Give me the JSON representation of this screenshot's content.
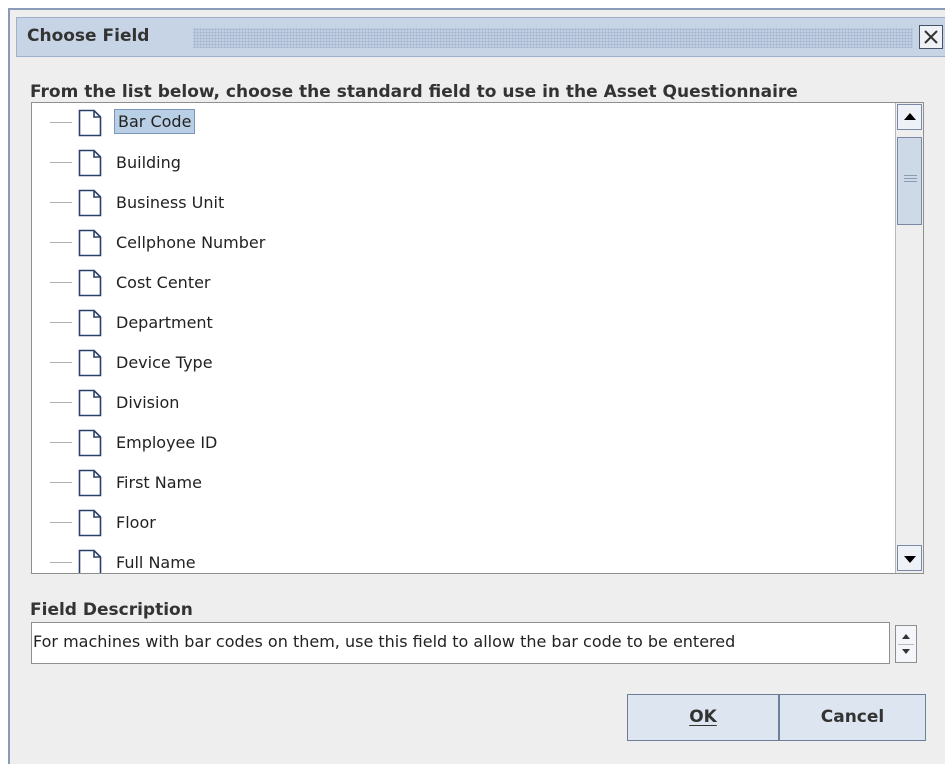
{
  "dialog": {
    "title": "Choose Field",
    "close_glyph": "☒"
  },
  "instruction": "From the list below, choose the standard field to use in the Asset Questionnaire",
  "tree": {
    "items": [
      {
        "label": "Bar Code",
        "selected": true
      },
      {
        "label": "Building"
      },
      {
        "label": "Business Unit"
      },
      {
        "label": "Cellphone Number"
      },
      {
        "label": "Cost Center"
      },
      {
        "label": "Department"
      },
      {
        "label": "Device Type"
      },
      {
        "label": "Division"
      },
      {
        "label": "Employee ID"
      },
      {
        "label": "First Name"
      },
      {
        "label": "Floor"
      },
      {
        "label": "Full Name"
      }
    ],
    "item_icon": "document-icon"
  },
  "description": {
    "label": "Field Description",
    "value": "For machines with bar codes on them, use this field to allow the bar code to be entered"
  },
  "buttons": {
    "ok": "OK",
    "cancel": "Cancel"
  },
  "colors": {
    "titlebar": "#c7d4e6",
    "selection": "#b8cfe5",
    "dialog_bg": "#eeeeee"
  }
}
